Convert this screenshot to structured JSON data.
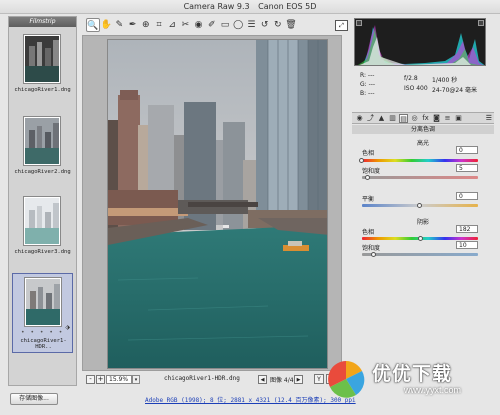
{
  "window": {
    "app_title": "Camera Raw 9.3",
    "camera": "Canon EOS 5D"
  },
  "filmstrip": {
    "header": "Filmstrip",
    "items": [
      {
        "label": "chicagoRiver1.dng",
        "selected": false
      },
      {
        "label": "chicagoRiver2.dng",
        "selected": false
      },
      {
        "label": "chicagoRiver3.dng",
        "selected": false
      },
      {
        "label": "chicagoRiver1-HDR.dng",
        "selected": true,
        "label_display": "chicagoRiver1-HDR..",
        "rating_dots": "• • • • •"
      }
    ]
  },
  "open_button": "存储图像...",
  "toolbar": {
    "tools": [
      "zoom-icon",
      "hand-icon",
      "white-balance-icon",
      "color-sampler-icon",
      "target-adjust-icon",
      "crop-icon",
      "straighten-icon",
      "spot-removal-icon",
      "red-eye-icon",
      "adjustment-brush-icon",
      "graduated-filter-icon",
      "radial-filter-icon",
      "preferences-icon",
      "rotate-ccw-icon",
      "rotate-cw-icon",
      "trash-icon"
    ],
    "tool_glyphs": [
      "🔍",
      "✋",
      "✎",
      "✒",
      "⊕",
      "⌗",
      "⊿",
      "✂",
      "◉",
      "✐",
      "▭",
      "◯",
      "☰",
      "↺",
      "↻",
      "🗑"
    ]
  },
  "bottom_bar": {
    "zoom_minus": "-",
    "zoom_plus": "+",
    "zoom_value": "15.9%",
    "filename": "chicagoRiver1-HDR.dng",
    "count_label": "图像 4/4",
    "view_y": "Y",
    "view_grid": "▦"
  },
  "workflow_link": "Adobe RGB (1998); 8 位; 2881 x 4321 (12.4 百万像素); 300 ppi",
  "info": {
    "r": "R: ---",
    "g": "G: ---",
    "b": "B: ---",
    "aperture": "f/2.8",
    "shutter": "1/400 秒",
    "iso": "ISO 400",
    "lens": "24-70@24 毫米"
  },
  "panel": {
    "title": "分离色调",
    "highlights": {
      "title": "高光",
      "hue_label": "色相",
      "hue_value": "0",
      "hue_frac": 0.0,
      "sat_label": "饱和度",
      "sat_value": "5",
      "sat_frac": 0.05
    },
    "balance": {
      "label": "平衡",
      "value": "0",
      "frac": 0.5
    },
    "shadows": {
      "title": "阴影",
      "hue_label": "色相",
      "hue_value": "182",
      "hue_frac": 0.505,
      "sat_label": "饱和度",
      "sat_value": "10",
      "sat_frac": 0.1
    }
  },
  "watermark": {
    "text": "优优下载",
    "url": "www.yyxt.com"
  }
}
